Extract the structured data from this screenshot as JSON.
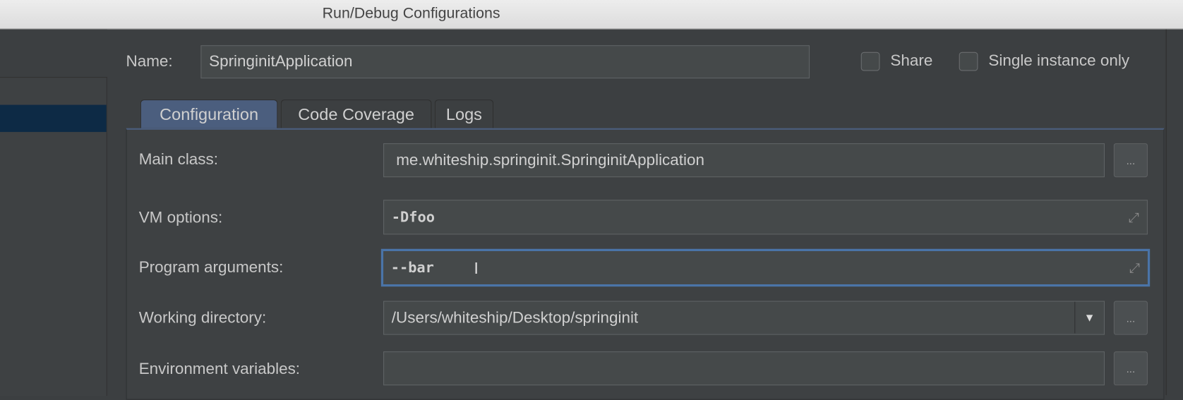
{
  "window": {
    "title": "Run/Debug Configurations"
  },
  "header": {
    "name_label": "Name:",
    "name_value": "SpringinitApplication",
    "share_label": "Share",
    "share_checked": false,
    "single_instance_label": "Single instance only",
    "single_instance_checked": false
  },
  "tabs": [
    {
      "label": "Configuration",
      "selected": true
    },
    {
      "label": "Code Coverage",
      "selected": false
    },
    {
      "label": "Logs",
      "selected": false
    }
  ],
  "form": {
    "main_class": {
      "label": "Main class:",
      "value": "me.whiteship.springinit.SpringinitApplication"
    },
    "vm_options": {
      "label": "VM options:",
      "value": "-Dfoo"
    },
    "program_arguments": {
      "label": "Program arguments:",
      "value": "--bar"
    },
    "working_directory": {
      "label": "Working directory:",
      "value": "/Users/whiteship/Desktop/springinit"
    },
    "environment_variables": {
      "label": "Environment variables:",
      "value": ""
    },
    "browse_label": "..."
  },
  "colors": {
    "selection": "#0d2a45",
    "tab_selected": "#4b5e7e",
    "focus": "#4a74a8"
  }
}
